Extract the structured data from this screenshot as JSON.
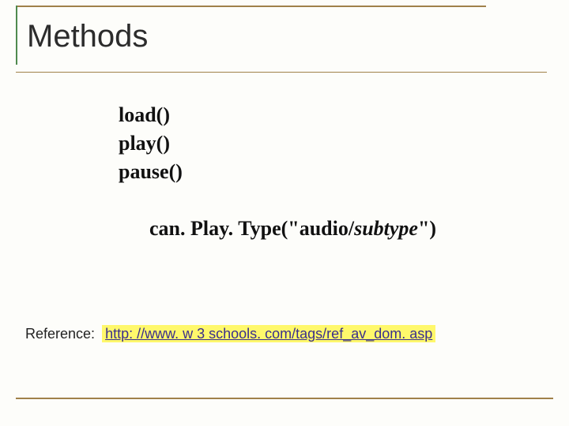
{
  "title": "Methods",
  "methods": {
    "m1": "load()",
    "m2": "play()",
    "m3": "pause()",
    "m4_prefix": "can. Play. Type(\"audio/",
    "m4_italic": "subtype",
    "m4_suffix": "\")"
  },
  "reference": {
    "label": "Reference:",
    "url_text": "http: //www. w 3 schools. com/tags/ref_av_dom. asp"
  }
}
